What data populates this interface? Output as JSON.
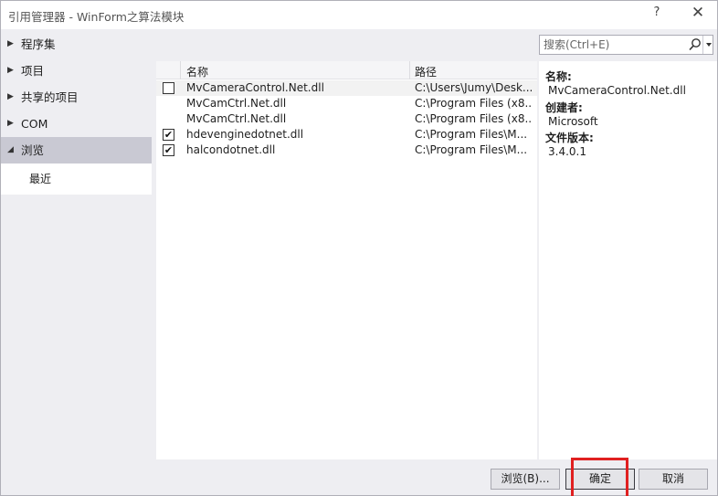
{
  "window": {
    "title": "引用管理器 - WinForm之算法模块",
    "help_label": "?",
    "close_label": "✕"
  },
  "nav": {
    "items": [
      {
        "label": "程序集",
        "arrow": "▶"
      },
      {
        "label": "项目",
        "arrow": "▶"
      },
      {
        "label": "共享的项目",
        "arrow": "▶"
      },
      {
        "label": "COM",
        "arrow": "▶"
      },
      {
        "label": "浏览",
        "arrow": "◢"
      }
    ],
    "sub_item": "最近"
  },
  "search": {
    "placeholder": "搜索(Ctrl+E)"
  },
  "list": {
    "columns": {
      "name": "名称",
      "path": "路径"
    },
    "rows": [
      {
        "name": "MvCameraControl.Net.dll",
        "path": "C:\\Users\\Jumy\\Desk...",
        "checkbox": true,
        "checked": false
      },
      {
        "name": "MvCamCtrl.Net.dll",
        "path": "C:\\Program Files (x8...",
        "checkbox": false,
        "checked": false
      },
      {
        "name": "MvCamCtrl.Net.dll",
        "path": "C:\\Program Files (x8...",
        "checkbox": false,
        "checked": false
      },
      {
        "name": "hdevenginedotnet.dll",
        "path": "C:\\Program Files\\M...",
        "checkbox": true,
        "checked": true
      },
      {
        "name": "halcondotnet.dll",
        "path": "C:\\Program Files\\M...",
        "checkbox": true,
        "checked": true
      }
    ]
  },
  "details": {
    "name_label": "名称:",
    "name_value": "MvCameraControl.Net.dll",
    "creator_label": "创建者:",
    "creator_value": "Microsoft",
    "version_label": "文件版本:",
    "version_value": "3.4.0.1"
  },
  "buttons": {
    "browse": "浏览(B)...",
    "ok": "确定",
    "cancel": "取消"
  },
  "colors": {
    "highlight": "#e02020",
    "selected_nav": "#c9c9d3"
  }
}
